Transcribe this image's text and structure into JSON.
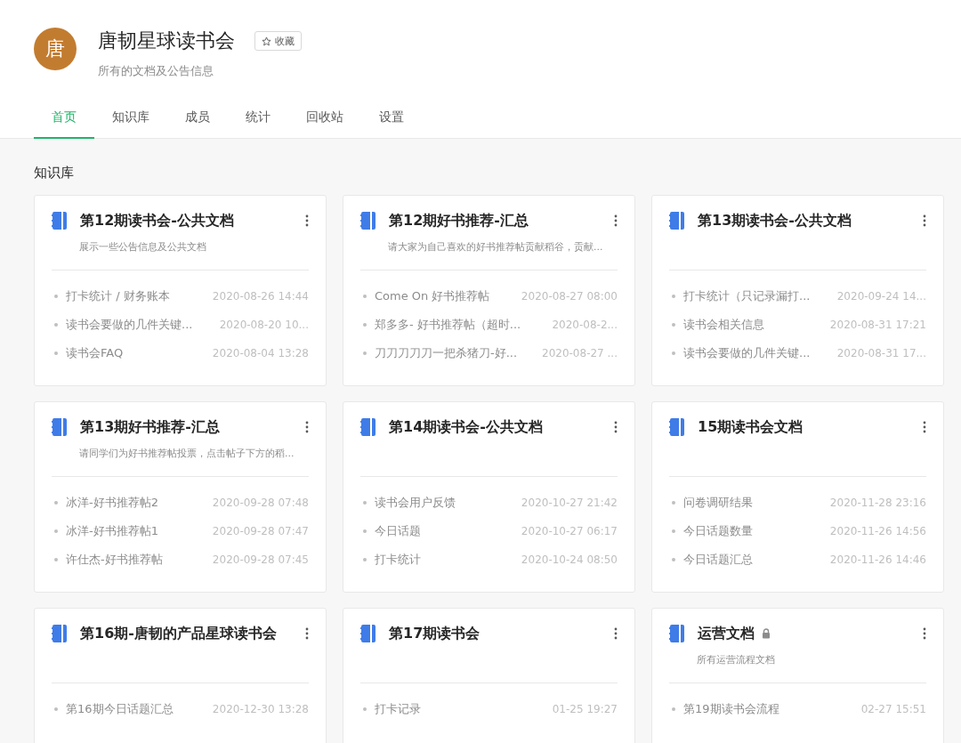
{
  "header": {
    "avatar": "唐",
    "title": "唐韧星球读书会",
    "favorite_button": "收藏",
    "subtitle": "所有的文档及公告信息"
  },
  "tabs": [
    {
      "label": "首页",
      "selected": true
    },
    {
      "label": "知识库",
      "selected": false
    },
    {
      "label": "成员",
      "selected": false
    },
    {
      "label": "统计",
      "selected": false
    },
    {
      "label": "回收站",
      "selected": false
    },
    {
      "label": "设置",
      "selected": false
    }
  ],
  "section_title": "知识库",
  "books": [
    {
      "title": "第12期读书会-公共文档",
      "locked": false,
      "description": "展示一些公告信息及公共文档",
      "docs": [
        {
          "title": "打卡统计 / 财务账本",
          "time": "2020-08-26 14:44"
        },
        {
          "title": "读书会要做的几件关键...",
          "time": "2020-08-20 10..."
        },
        {
          "title": "读书会FAQ",
          "time": "2020-08-04 13:28"
        }
      ]
    },
    {
      "title": "第12期好书推荐-汇总",
      "locked": false,
      "description": "请大家为自己喜欢的好书推荐帖贡献稻谷，贡献...",
      "docs": [
        {
          "title": "Come On 好书推荐帖",
          "time": "2020-08-27 08:00"
        },
        {
          "title": "郑多多- 好书推荐帖（超时...",
          "time": "2020-08-2..."
        },
        {
          "title": "刀刀刀刀刀一把杀猪刀-好...",
          "time": "2020-08-27 ..."
        }
      ]
    },
    {
      "title": "第13期读书会-公共文档",
      "locked": false,
      "docs": [
        {
          "title": "打卡统计（只记录漏打...",
          "time": "2020-09-24 14..."
        },
        {
          "title": "读书会相关信息",
          "time": "2020-08-31 17:21"
        },
        {
          "title": "读书会要做的几件关键...",
          "time": "2020-08-31 17..."
        }
      ]
    },
    {
      "title": "第13期好书推荐-汇总",
      "locked": false,
      "description": "请同学们为好书推荐帖投票，点击帖子下方的稻...",
      "docs": [
        {
          "title": "冰洋-好书推荐帖2",
          "time": "2020-09-28 07:48"
        },
        {
          "title": "冰洋-好书推荐帖1",
          "time": "2020-09-28 07:47"
        },
        {
          "title": "许仕杰-好书推荐帖",
          "time": "2020-09-28 07:45"
        }
      ]
    },
    {
      "title": "第14期读书会-公共文档",
      "locked": false,
      "docs": [
        {
          "title": "读书会用户反馈",
          "time": "2020-10-27 21:42"
        },
        {
          "title": "今日话题",
          "time": "2020-10-27 06:17"
        },
        {
          "title": "打卡统计",
          "time": "2020-10-24 08:50"
        }
      ]
    },
    {
      "title": "15期读书会文档",
      "locked": false,
      "docs": [
        {
          "title": "问卷调研结果",
          "time": "2020-11-28 23:16"
        },
        {
          "title": "今日话题数量",
          "time": "2020-11-26 14:56"
        },
        {
          "title": "今日话题汇总",
          "time": "2020-11-26 14:46"
        }
      ]
    },
    {
      "title": "第16期-唐韧的产品星球读书会",
      "locked": false,
      "docs": [
        {
          "title": "第16期今日话题汇总",
          "time": "2020-12-30 13:28"
        }
      ]
    },
    {
      "title": "第17期读书会",
      "locked": false,
      "docs": [
        {
          "title": "打卡记录",
          "time": "01-25 19:27"
        }
      ]
    },
    {
      "title": "运营文档",
      "locked": true,
      "description": "所有运营流程文档",
      "docs": [
        {
          "title": "第19期读书会流程",
          "time": "02-27 15:51"
        }
      ]
    }
  ]
}
